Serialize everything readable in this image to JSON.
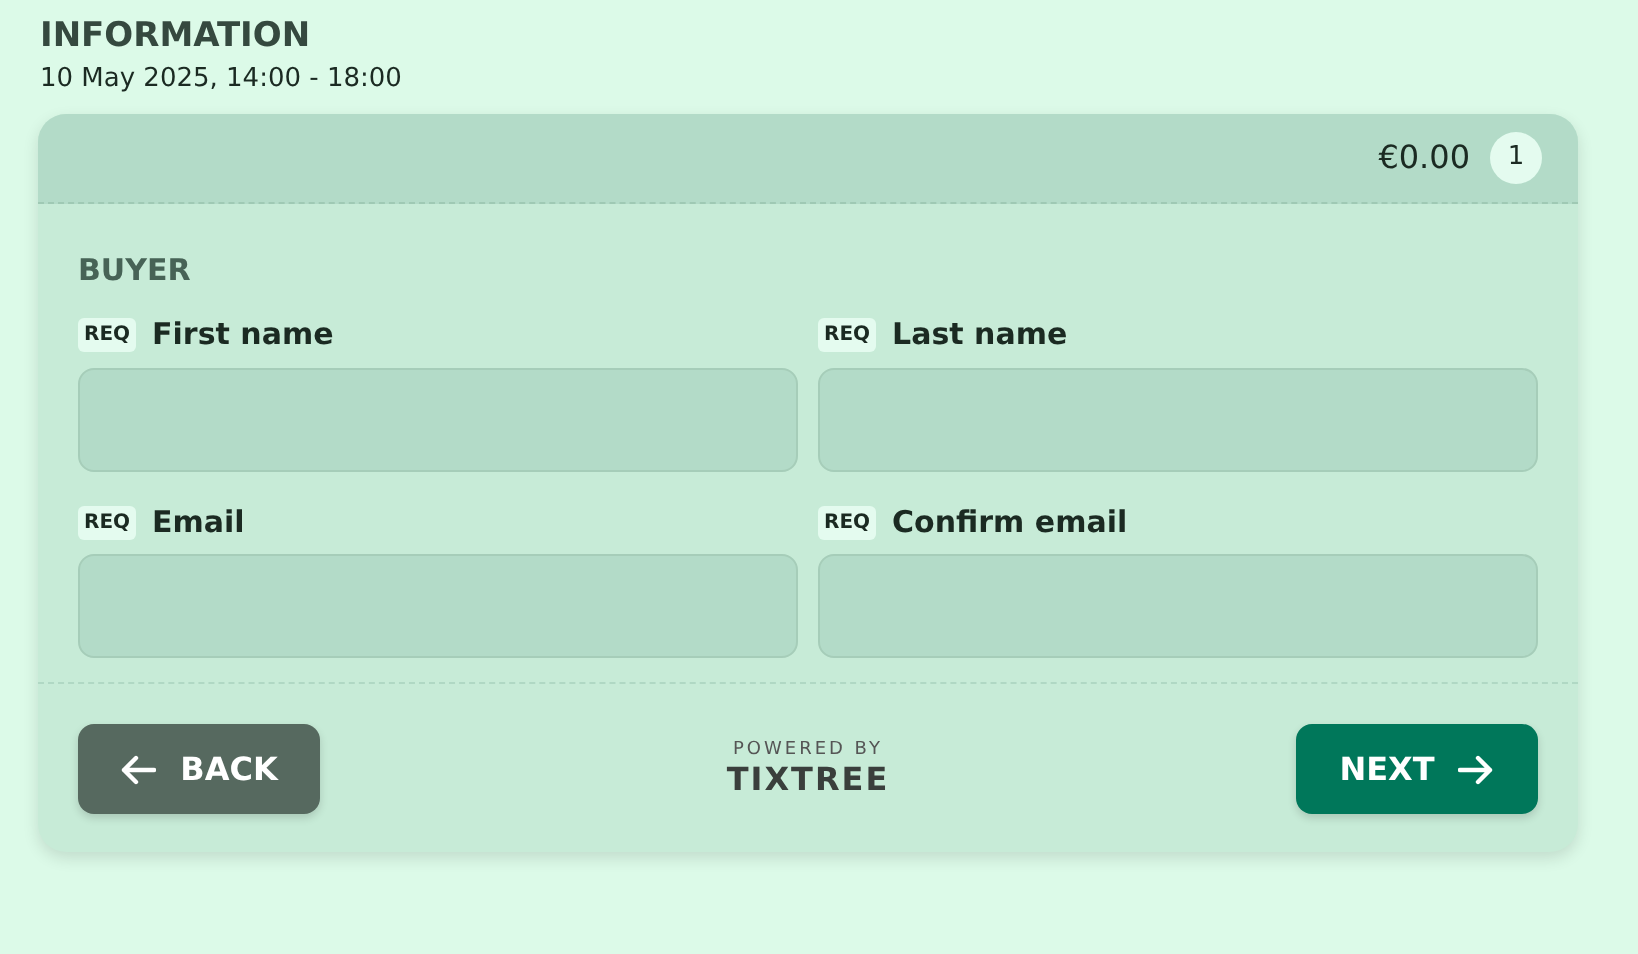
{
  "page": {
    "title": "INFORMATION",
    "subtitle": "10 May 2025, 14:00 - 18:00"
  },
  "cart": {
    "total": "€0.00",
    "count": "1"
  },
  "section": {
    "title": "BUYER"
  },
  "fields": [
    {
      "label": "First name",
      "required": true,
      "badge": "REQ"
    },
    {
      "label": "Last name",
      "required": true,
      "badge": "REQ"
    },
    {
      "label": "Email",
      "required": true,
      "badge": "REQ"
    },
    {
      "label": "Confirm email",
      "required": true,
      "badge": "REQ"
    }
  ],
  "footer": {
    "back": "BACK",
    "next": "NEXT",
    "powered_by": "POWERED BY",
    "brand": "TIXTREE"
  }
}
